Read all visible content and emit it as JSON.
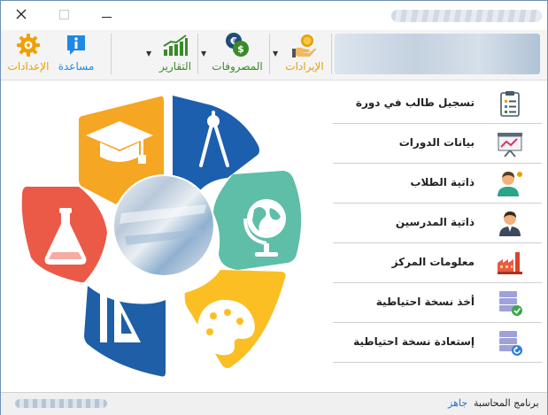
{
  "window": {
    "close_icon": "close-icon",
    "maximize_icon": "maximize-icon",
    "minimize_icon": "minimize-icon"
  },
  "ribbon": {
    "revenues": {
      "label": "الإيرادات",
      "color": "#e8a000",
      "icon": "hand-coin-icon"
    },
    "expenses": {
      "label": "المصروفات",
      "color": "#3a8a2a",
      "icon": "currency-exchange-icon"
    },
    "reports": {
      "label": "التقارير",
      "color": "#3a8a2a",
      "icon": "bar-chart-icon"
    },
    "help": {
      "label": "مساعدة",
      "color": "#1e88e5",
      "icon": "info-icon"
    },
    "settings": {
      "label": "الإعدادات",
      "color": "#e8a000",
      "icon": "gear-icon"
    }
  },
  "menu": [
    {
      "label": "تسجيل طالب في دورة",
      "icon": "clipboard-checklist-icon"
    },
    {
      "label": "بيانات الدورات",
      "icon": "presentation-chart-icon"
    },
    {
      "label": "ذاتية الطلاب",
      "icon": "student-icon"
    },
    {
      "label": "ذاتية المدرسين",
      "icon": "teacher-icon"
    },
    {
      "label": "معلومات المركز",
      "icon": "factory-icon"
    },
    {
      "label": "أخذ نسخة احتياطية",
      "icon": "database-backup-icon"
    },
    {
      "label": "إستعادة نسخة احتياطية",
      "icon": "database-restore-icon"
    }
  ],
  "status": {
    "state": "جاهز",
    "app_name": "برنامج المحاسبة"
  }
}
